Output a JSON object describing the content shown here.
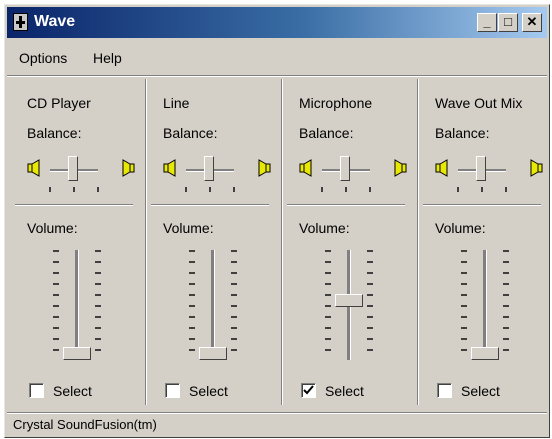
{
  "window": {
    "title": "Wave",
    "buttons": {
      "minimize": "_",
      "maximize": "□",
      "close": "✕"
    }
  },
  "menu": [
    {
      "label": "Options"
    },
    {
      "label": "Help"
    }
  ],
  "channels": [
    {
      "name": "CD Player",
      "balance_label": "Balance:",
      "volume_label": "Volume:",
      "select_label": "Select",
      "selected": false,
      "balance": 0.5,
      "volume": 0.0
    },
    {
      "name": "Line",
      "balance_label": "Balance:",
      "volume_label": "Volume:",
      "select_label": "Select",
      "selected": false,
      "balance": 0.5,
      "volume": 0.0
    },
    {
      "name": "Microphone",
      "balance_label": "Balance:",
      "volume_label": "Volume:",
      "select_label": "Select",
      "selected": true,
      "balance": 0.5,
      "volume": 0.55
    },
    {
      "name": "Wave Out Mix",
      "balance_label": "Balance:",
      "volume_label": "Volume:",
      "select_label": "Select",
      "selected": false,
      "balance": 0.5,
      "volume": 0.0
    }
  ],
  "status": {
    "text": "Crystal SoundFusion(tm)"
  },
  "icons": {
    "app": "volume-control-icon",
    "left_speaker": "speaker-left-icon",
    "right_speaker": "speaker-right-icon"
  },
  "colors": {
    "title_gradient_start": "#0a246a",
    "title_gradient_end": "#a6caf0",
    "face": "#d4d0c8",
    "speaker_yellow": "#e8e800"
  }
}
